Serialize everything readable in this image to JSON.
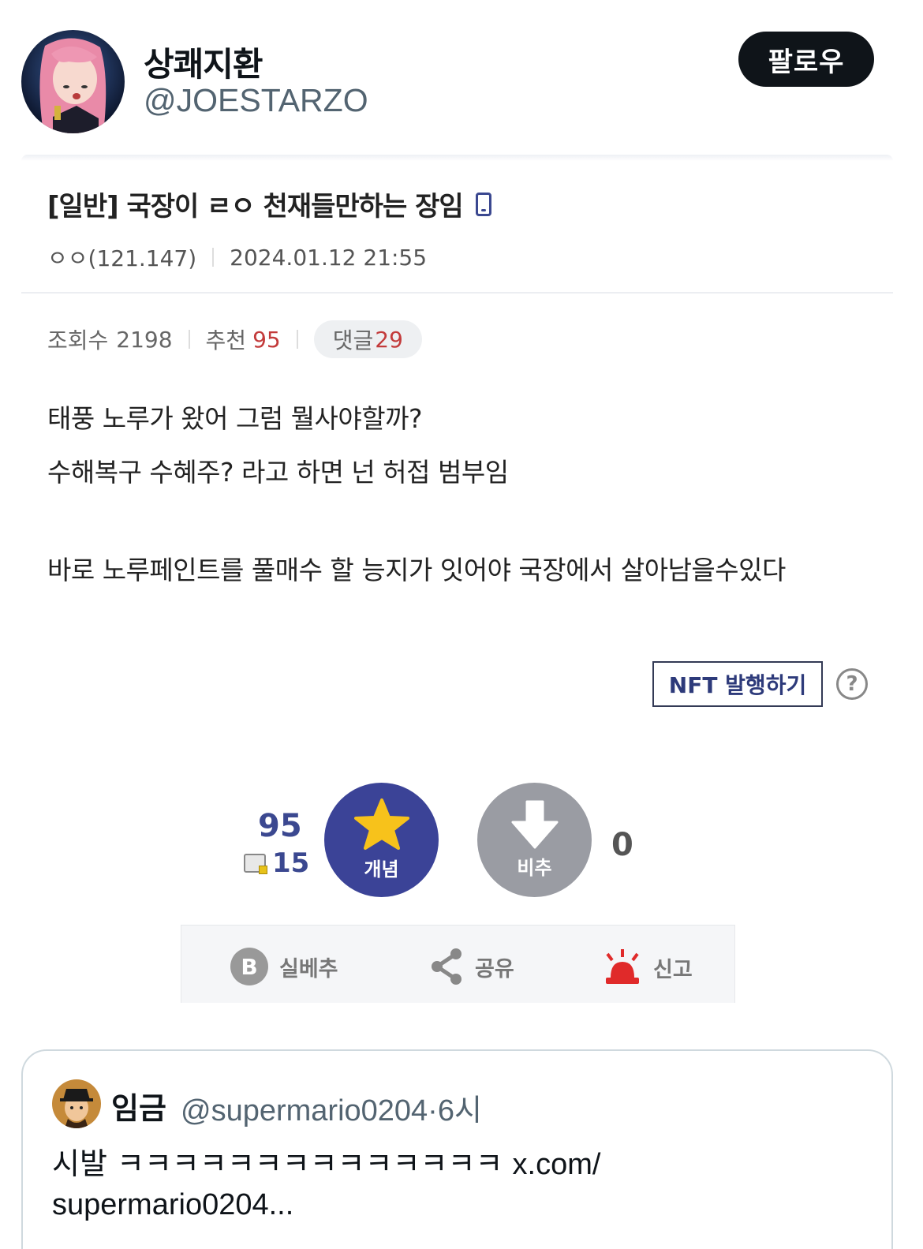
{
  "author": {
    "display_name": "상쾌지환",
    "handle": "@JOESTARZO",
    "follow_label": "팔로우"
  },
  "post": {
    "title": "[일반] 국장이 ㄹㅇ 천재들만하는 장임",
    "writer": "ㅇㅇ(121.147)",
    "datetime": "2024.01.12 21:55",
    "views_label": "조회수",
    "views": "2198",
    "recommend_label": "추천",
    "recommend": "95",
    "comments_label": "댓글",
    "comments": "29",
    "body": [
      "태풍 노루가 왔어 그럼 뭘사야할까?",
      "수해복구 수혜주? 라고 하면 넌 허접 범부임",
      "바로 노루페인트를 풀매수 할 능지가 잇어야 국장에서 살아남을수있다"
    ],
    "nft_label": "NFT 발행하기",
    "help_symbol": "?",
    "upvote_count": "95",
    "fixed_count": "15",
    "upvote_label": "개념",
    "downvote_label": "비추",
    "downvote_count": "0",
    "actions": {
      "silbe_symbol": "B",
      "silbe": "실베추",
      "share": "공유",
      "report": "신고"
    }
  },
  "quote": {
    "name": "임금",
    "handle_time": "@supermario0204·6시",
    "text_prefix": "시발 ㅋㅋㅋㅋㅋㅋㅋㅋㅋㅋㅋㅋㅋㅋ ",
    "link_part1": "x.com/",
    "link_part2": "supermario0204..."
  },
  "colors": {
    "accent_blue": "#3b4397",
    "downvote_gray": "#9a9ca3",
    "red": "#c33b3b",
    "follow_bg": "#0f1419"
  }
}
